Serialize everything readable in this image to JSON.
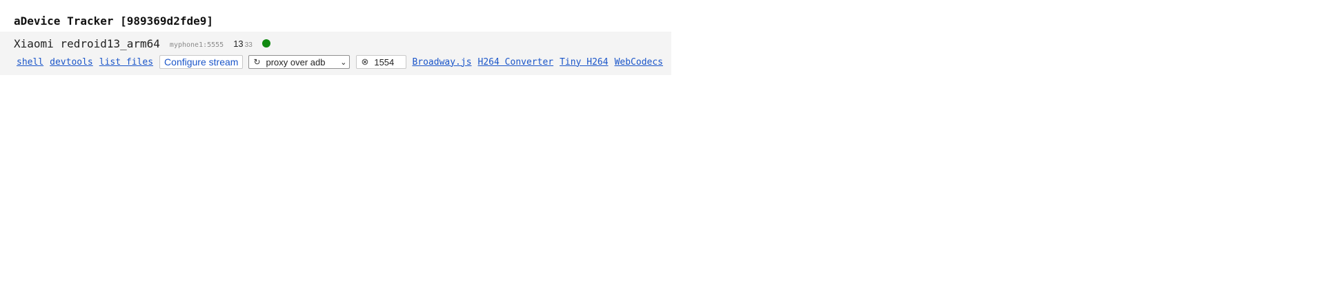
{
  "tracker": {
    "title": "aDevice Tracker [989369d2fde9]"
  },
  "device": {
    "name": "Xiaomi redroid13_arm64",
    "serial": "myphone1:5555",
    "version_main": "13",
    "version_sub": "33",
    "status_color": "#118a11"
  },
  "actions": {
    "shell": "shell",
    "devtools": "devtools",
    "list_files": "list files",
    "configure_stream": "Configure stream",
    "proxy_select_value": "proxy over adb",
    "port_value": "1554",
    "players": [
      "Broadway.js",
      "H264 Converter",
      "Tiny H264",
      "WebCodecs"
    ]
  },
  "icons": {
    "refresh": "refresh-icon",
    "close_circle": "close-circle-icon",
    "chevron": "chevron-down-icon",
    "status": "status-dot-icon"
  },
  "colors": {
    "link": "#1a55c9",
    "panel_bg": "#f4f4f4"
  }
}
